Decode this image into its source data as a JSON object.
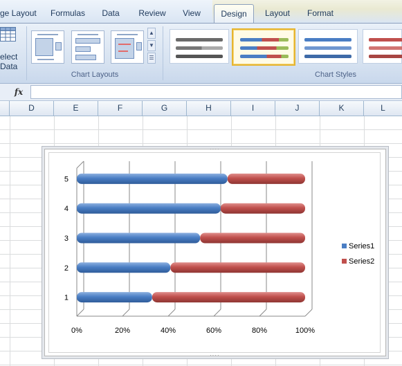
{
  "ribbon": {
    "tabs": [
      {
        "label": "ge Layout",
        "active": false
      },
      {
        "label": "Formulas",
        "active": false
      },
      {
        "label": "Data",
        "active": false
      },
      {
        "label": "Review",
        "active": false
      },
      {
        "label": "View",
        "active": false
      },
      {
        "label": "Design",
        "active": true
      },
      {
        "label": "Layout",
        "active": false
      },
      {
        "label": "Format",
        "active": false
      }
    ],
    "select_data": {
      "line1": "elect",
      "line2": "Data",
      "icon": "table-icon"
    },
    "groups": {
      "chart_layouts": "Chart Layouts",
      "chart_styles": "Chart Styles"
    }
  },
  "formula_bar": {
    "fx_label": "fx",
    "value": ""
  },
  "columns": [
    "D",
    "E",
    "F",
    "G",
    "H",
    "I",
    "J",
    "K",
    "L"
  ],
  "chart_data": {
    "type": "bar",
    "orientation": "horizontal",
    "stacked": "100%",
    "categories": [
      "1",
      "2",
      "3",
      "4",
      "5"
    ],
    "series": [
      {
        "name": "Series1",
        "values": [
          33,
          41,
          54,
          63,
          66
        ],
        "color": "#4a7ec4"
      },
      {
        "name": "Series2",
        "values": [
          67,
          59,
          46,
          37,
          34
        ],
        "color": "#c0504d"
      }
    ],
    "xticks": [
      "0%",
      "20%",
      "40%",
      "60%",
      "80%",
      "100%"
    ],
    "xlim": [
      0,
      100
    ],
    "grid": true,
    "legend": "right"
  },
  "colors": {
    "series1": "#4a7ec4",
    "series2": "#c0504d",
    "selection": "#e6b530"
  }
}
